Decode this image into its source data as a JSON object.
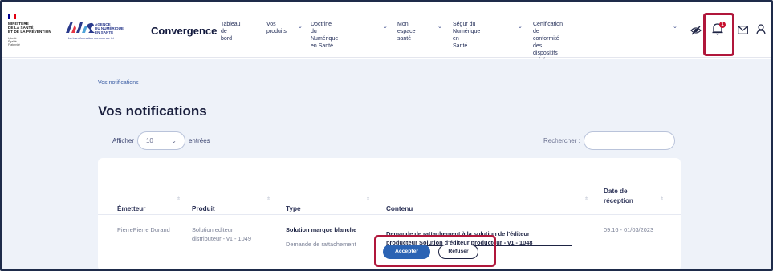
{
  "header": {
    "gov_logo_lines": [
      "MINISTÈRE",
      "DE LA SANTÉ",
      "ET DE LA PRÉVENTION"
    ],
    "gov_motto": "Liberté\nÉgalité\nFraternité",
    "ans_logo_lines": [
      "AGENCE",
      "DU NUMÉRIQUE",
      "EN SANTÉ"
    ],
    "ans_tagline": "La transformation commence ici",
    "brand": "Convergence",
    "nav": [
      {
        "label": "Tableau de\nbord",
        "has_chevron": false
      },
      {
        "label": "Vos\nproduits",
        "has_chevron": true
      },
      {
        "label": "Doctrine du Numérique\nen Santé",
        "has_chevron": true
      },
      {
        "label": "Mon espace\nsanté",
        "has_chevron": true
      },
      {
        "label": "Ségur du Numérique en\nSanté",
        "has_chevron": true
      },
      {
        "label": "Certification de conformité des dispositifs\nmédicaux numériques",
        "has_chevron": true
      }
    ],
    "icons": [
      "eye-slash-icon",
      "bell-icon",
      "mail-icon",
      "user-icon"
    ],
    "notification_count": "1"
  },
  "page": {
    "breadcrumb": "Vos notifications",
    "title": "Vos notifications",
    "show_label": "Afficher",
    "page_size": "10",
    "entries_label": "entrées",
    "search_label": "Rechercher :",
    "search_value": ""
  },
  "table": {
    "columns": [
      "Émetteur",
      "Produit",
      "Type",
      "Contenu",
      "Date de\nréception"
    ],
    "rows": [
      {
        "emitter": "PierrePierre Durand",
        "product": "Solution editeur\ndistributeur - v1 - 1049",
        "type_title": "Solution marque blanche",
        "type_sub": "Demande de rattachement",
        "content_line1": "Demande de rattachement à la solution de l'éditeur",
        "content_line2": "producteur Solution d'éditeur producteur - v1 - 1048",
        "date": "09:16 - 01/03/2023",
        "accept_label": "Accepter",
        "refuse_label": "Refuser"
      }
    ]
  },
  "colors": {
    "accent": "#2b63b4",
    "highlight": "#b0173b",
    "badge": "#c8102e",
    "page_bg": "#eef2f9"
  }
}
